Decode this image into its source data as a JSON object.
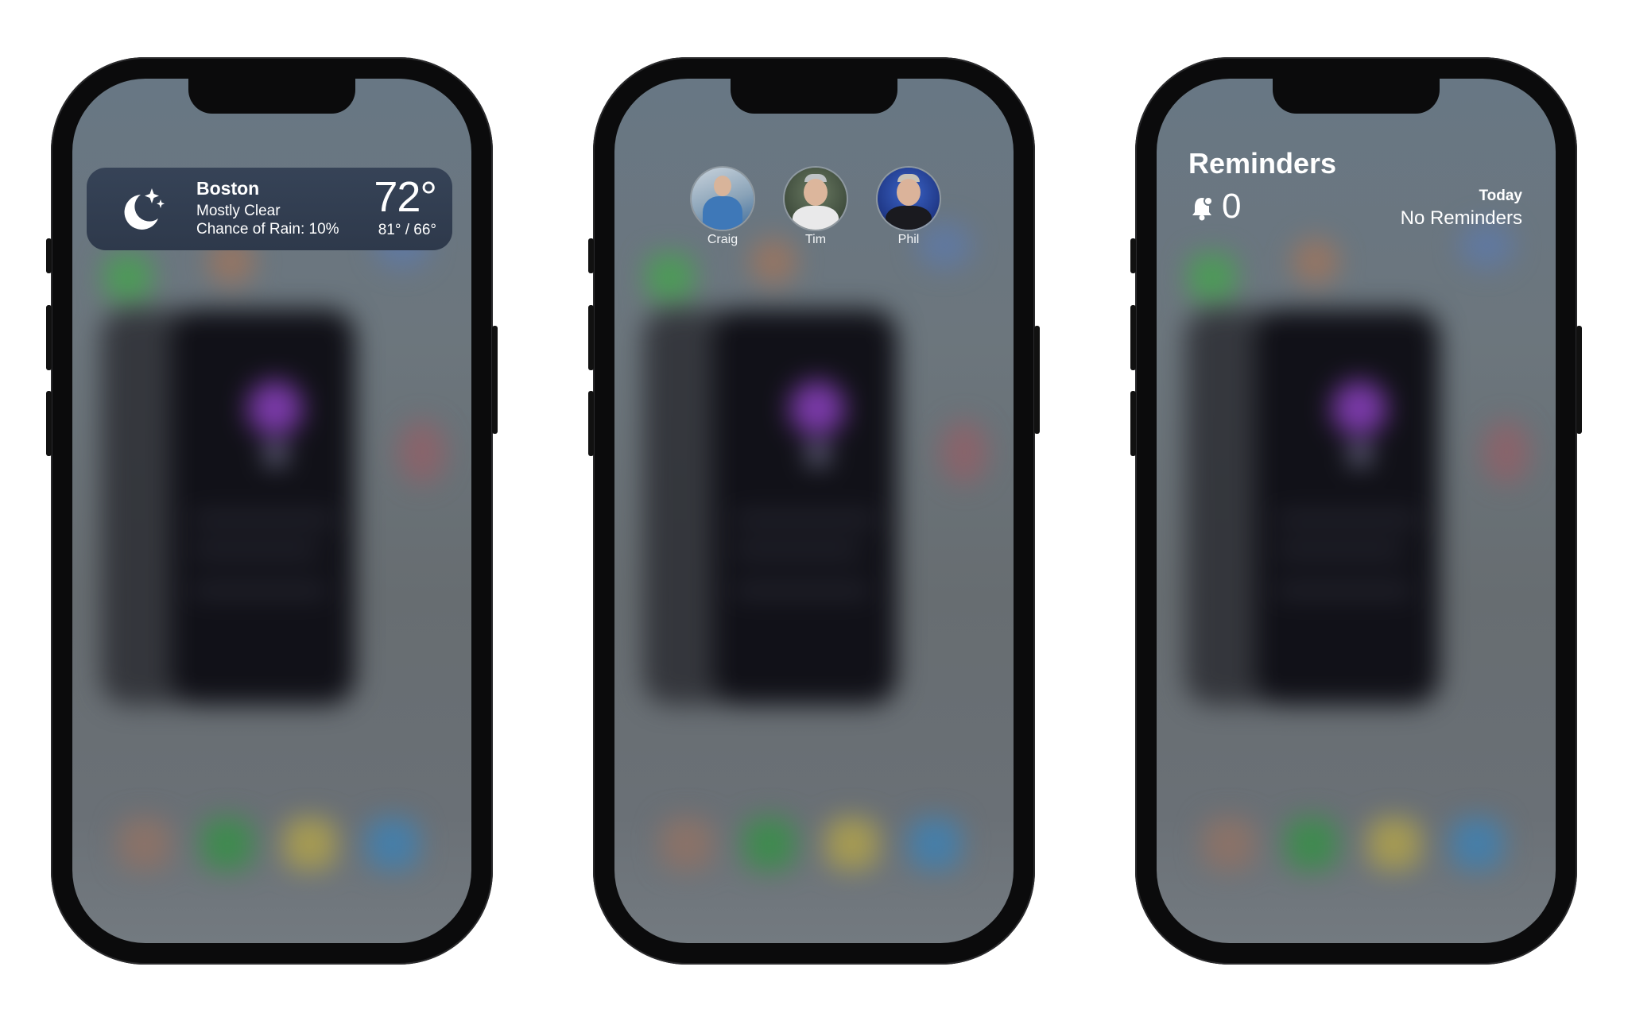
{
  "phones": [
    {
      "widget": "weather",
      "weather": {
        "city": "Boston",
        "condition": "Mostly Clear",
        "rain": "Chance of Rain: 10%",
        "temperature": "72°",
        "high_low": "81° / 66°",
        "icon": "moon-stars-icon"
      }
    },
    {
      "widget": "contacts",
      "contacts": [
        {
          "name": "Craig",
          "avatar_color": "#8aa3b8"
        },
        {
          "name": "Tim",
          "avatar_color": "#7a8a70"
        },
        {
          "name": "Phil",
          "avatar_color": "#1f3f8a"
        }
      ]
    },
    {
      "widget": "reminders",
      "reminders": {
        "title": "Reminders",
        "count": "0",
        "today_label": "Today",
        "status": "No Reminders",
        "icon": "bell-icon"
      }
    }
  ],
  "colors": {
    "frame": "#0b0b0c",
    "weather_widget": "#323e52",
    "blurred_app_dock": [
      "#8a7268",
      "#3f8a4f",
      "#a59a53",
      "#467ea8"
    ]
  }
}
